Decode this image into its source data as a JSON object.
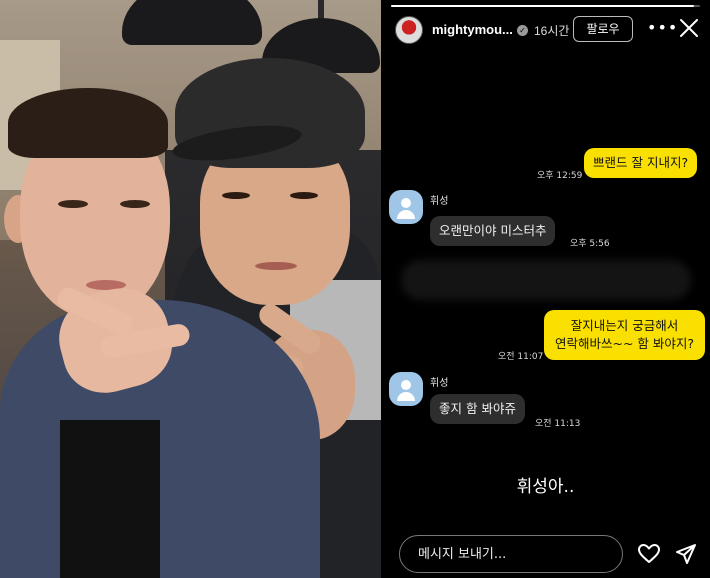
{
  "story": {
    "progress": 0.98,
    "header": {
      "username": "mightymou...",
      "time_ago": "16시간",
      "follow_label": "팔로우",
      "more_label": "•••"
    },
    "chat": {
      "messages": [
        {
          "side": "sent",
          "text": "쁘랜드 잘 지내지?",
          "time": "오후 12:59"
        },
        {
          "side": "recv",
          "sender": "휘성",
          "text": "오랜만이야 미스터추",
          "time": "오후 5:56"
        },
        {
          "side": "sent",
          "text": "잘지내는지 궁금해서\n연락해바쓰~~ 함 봐야지?",
          "time": "오전 11:07"
        },
        {
          "side": "recv",
          "sender": "휘성",
          "text": "좋지 함 봐야쥬",
          "time": "오전 11:13"
        }
      ]
    },
    "caption": "휘성아..",
    "footer": {
      "message_placeholder": "메시지 보내기..."
    },
    "colors": {
      "sent_bubble": "#f9e000",
      "recv_bubble": "#2e2e2e",
      "background": "#000000"
    }
  }
}
